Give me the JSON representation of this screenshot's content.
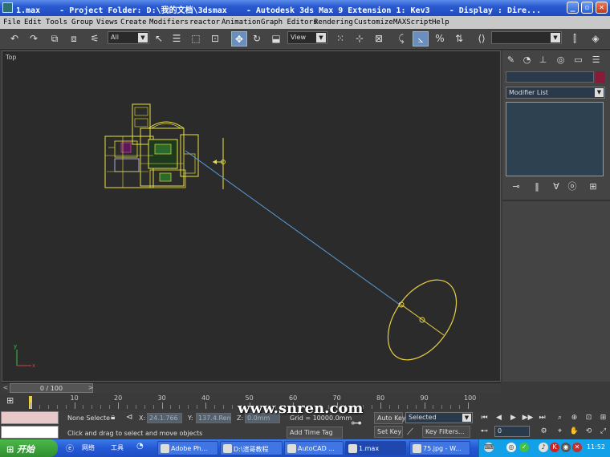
{
  "window": {
    "title": "1.max    - Project Folder: D:\\我的文档\\3dsmax    - Autodesk 3ds Max 9 Extension 1: Kev3    - Display : Dire..."
  },
  "menu": [
    "File",
    "Edit",
    "Tools",
    "Group",
    "Views",
    "Create",
    "Modifiers",
    "reactor",
    "Animation",
    "Graph Editors",
    "Rendering",
    "Customize",
    "MAXScript",
    "Help"
  ],
  "toolbar": {
    "selection_filter": "All",
    "ref_coord": "View"
  },
  "viewport": {
    "label": "Top"
  },
  "command_panel": {
    "modifier_list": "Modifier List",
    "object_color": "#8a1a3a"
  },
  "time_slider": {
    "position": "0 / 100",
    "prev_icon": "<",
    "next_icon": ">"
  },
  "track": {
    "labels": [
      "10",
      "20",
      "30",
      "40",
      "50",
      "60",
      "70",
      "80",
      "90",
      "100"
    ]
  },
  "status": {
    "selection": "None Selecte",
    "x_value": "24.1.766",
    "y_value": "137.4.Rem",
    "z_label": "Z:",
    "z_value": "0.0mm",
    "x_label": "X:",
    "y_label": "Y:",
    "grid": "Grid = 10000.0mm",
    "prompt": "Click and drag to select and move objects",
    "add_time_tag": "Add Time Tag",
    "auto_key": "Auto Key",
    "set_key": "Set Key",
    "key_mode": "Selected",
    "key_filters": "Key Filters...",
    "frame": "0"
  },
  "watermark": "www.snren.com",
  "taskbar": {
    "start": "开始",
    "quicklaunch": [
      "网络",
      "工具"
    ],
    "tasks": [
      "Adobe Ph...",
      "D:\\渲哥教程",
      "AutoCAD ...",
      "1.max",
      "75.jpg - W..."
    ],
    "active_task": "1.max",
    "clock": "11:52"
  }
}
